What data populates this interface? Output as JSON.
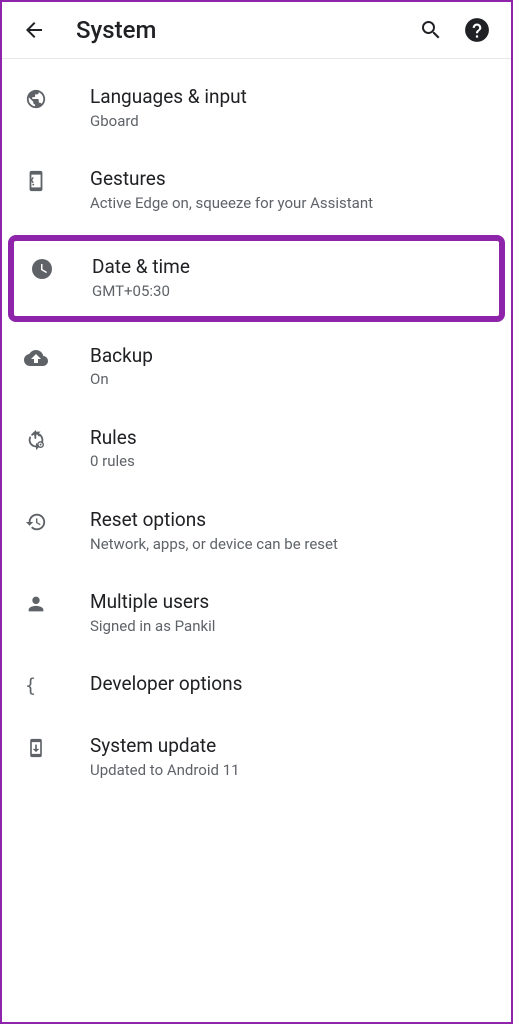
{
  "header": {
    "title": "System"
  },
  "items": [
    {
      "title": "Languages & input",
      "subtitle": "Gboard"
    },
    {
      "title": "Gestures",
      "subtitle": "Active Edge on, squeeze for your Assistant"
    },
    {
      "title": "Date & time",
      "subtitle": "GMT+05:30"
    },
    {
      "title": "Backup",
      "subtitle": "On"
    },
    {
      "title": "Rules",
      "subtitle": "0 rules"
    },
    {
      "title": "Reset options",
      "subtitle": "Network, apps, or device can be reset"
    },
    {
      "title": "Multiple users",
      "subtitle": "Signed in as Pankil"
    },
    {
      "title": "Developer options",
      "subtitle": ""
    },
    {
      "title": "System update",
      "subtitle": "Updated to Android 11"
    }
  ]
}
